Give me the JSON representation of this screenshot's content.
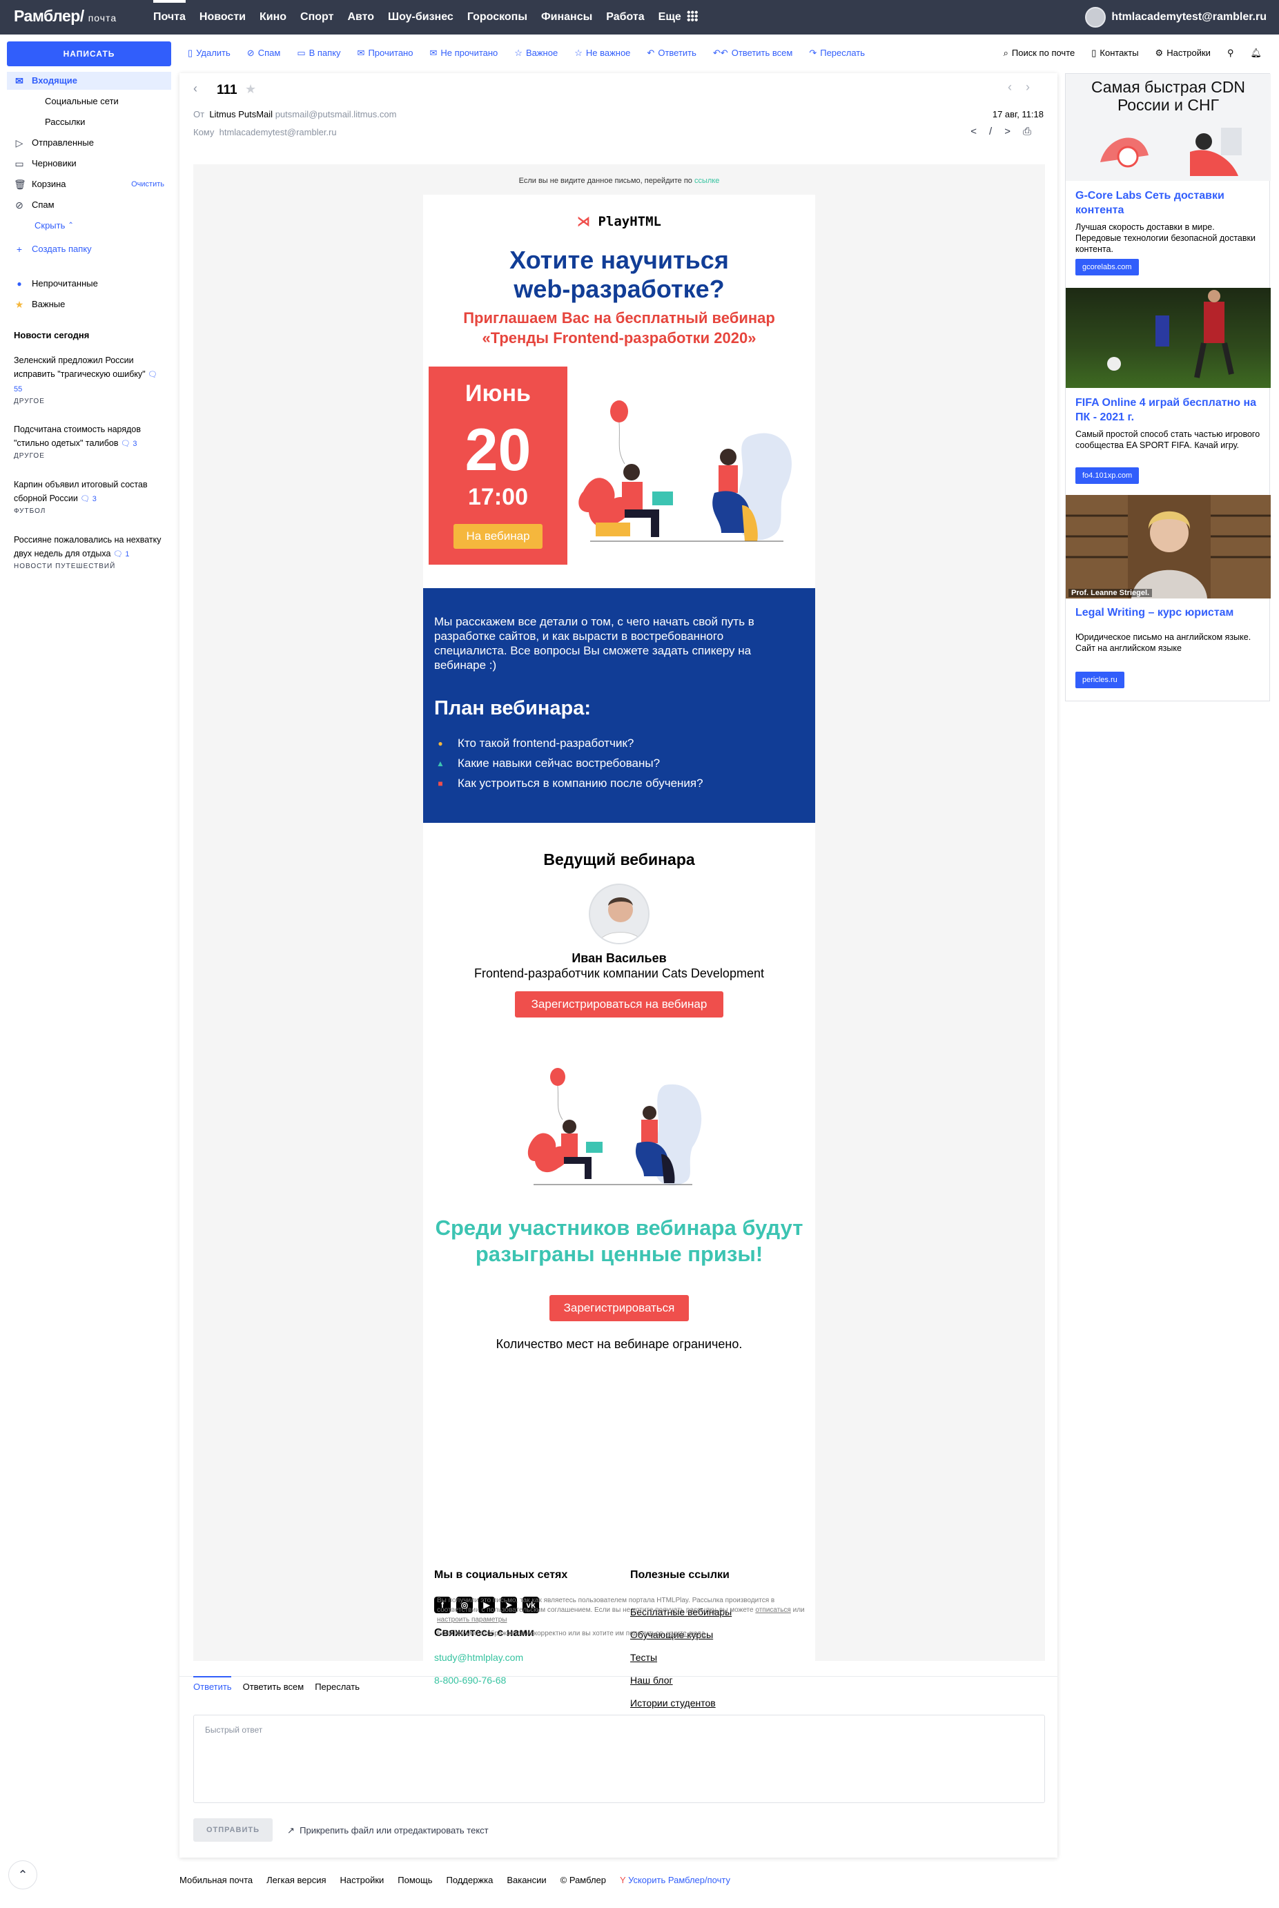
{
  "topbar": {
    "logo": "Рамблер/",
    "logo_sub": "почта",
    "nav": [
      "Почта",
      "Новости",
      "Кино",
      "Спорт",
      "Авто",
      "Шоу-бизнес",
      "Гороскопы",
      "Финансы",
      "Работа",
      "Еще"
    ],
    "account": "htmlacademytest@rambler.ru"
  },
  "sidebar": {
    "compose": "НАПИСАТЬ",
    "folders": {
      "inbox": "Входящие",
      "social": "Социальные сети",
      "mailings": "Рассылки",
      "sent": "Отправленные",
      "drafts": "Черновики",
      "trash": "Корзина",
      "trash_action": "Очистить",
      "spam": "Спам",
      "hide": "Скрыть",
      "create": "Создать папку",
      "unread": "Непрочитанные",
      "important": "Важные"
    },
    "news_title": "Новости сегодня",
    "news": [
      {
        "text": "Зеленский предложил России исправить \"трагическую ошибку\"",
        "comments": "55",
        "category": "ДРУГОЕ"
      },
      {
        "text": "Подсчитана стоимость нарядов \"стильно одетых\" талибов",
        "comments": "3",
        "category": "ДРУГОЕ"
      },
      {
        "text": "Карпин объявил итоговый состав сборной России",
        "comments": "3",
        "category": "ФУТБОЛ"
      },
      {
        "text": "Россияне пожаловались на нехватку двух недель для отдыха",
        "comments": "1",
        "category": "НОВОСТИ ПУТЕШЕСТВИЙ"
      }
    ]
  },
  "toolbar": {
    "delete": "Удалить",
    "spam": "Спам",
    "to_folder": "В папку",
    "read": "Прочитано",
    "unread": "Не прочитано",
    "important": "Важное",
    "not_important": "Не важное",
    "reply": "Ответить",
    "reply_all": "Ответить всем",
    "forward": "Переслать",
    "search": "Поиск по почте",
    "contacts": "Контакты",
    "settings": "Настройки"
  },
  "message": {
    "subject": "111",
    "from_label": "От",
    "from_name": "Litmus PutsMail",
    "from_email": "putsmail@putsmail.litmus.com",
    "to_label": "Кому",
    "to_email": "htmlacademytest@rambler.ru",
    "date": "17 авг, 11:18"
  },
  "email": {
    "noview_text": "Если вы не видите данное письмо, перейдите по",
    "noview_link": "ссылке",
    "brand": "PlayHTML",
    "h1_line1": "Хотите научиться",
    "h1_line2": "web-разработке?",
    "h2_line1": "Приглашаем Вас на бесплатный вебинар",
    "h2_line2": "«Тренды Frontend-разработки 2020»",
    "month": "Июнь",
    "day": "20",
    "time": "17:00",
    "date_button": "На вебинар",
    "intro": "Мы расскажем все детали о том, с чего начать свой путь в разработке сайтов, и как вырасти в востребованного специалиста. Все вопросы Вы сможете задать спикеру на вебинаре :)",
    "plan_title": "План вебинара:",
    "plan": [
      "Кто такой frontend-разработчик?",
      "Какие навыки сейчас востребованы?",
      "Как устроиться в компанию после обучения?"
    ],
    "plan_colors": [
      "#f5b73d",
      "#3cc4b2",
      "#ef4f4c"
    ],
    "host_title": "Ведущий вебинара",
    "host_name": "Иван Васильев",
    "host_role": "Frontend-разработчик компании Cats Development",
    "register_webinar": "Зарегистрироваться на вебинар",
    "prize_line1": "Среди участников вебинара будут",
    "prize_line2": "разыграны ценные призы!",
    "register": "Зарегистрироваться",
    "limited": "Количество мест на вебинаре ограничено.",
    "social_title": "Мы в социальных сетях",
    "social_icons": [
      "facebook-icon",
      "instagram-icon",
      "youtube-icon",
      "telegram-icon",
      "vk-icon"
    ],
    "contact_title": "Свяжитесь с нами",
    "contact_email": "study@htmlplay.com",
    "contact_phone": "8-800-690-76-68",
    "links_title": "Полезные ссылки",
    "links": [
      "Бесплатные вебинары",
      "Обучающие курсы",
      "Тесты",
      "Наш блог",
      "Истории студентов"
    ],
    "legal_1": "Вы получили это письмо, так как являетесь пользователем портала HTMLPlay. Рассылка производится в соответствии с пользовательским соглашением. Если вы не хотите получать рассылку, вы можете",
    "legal_unsub": "отписаться",
    "legal_or": "или",
    "legal_settings": "настроить параметры",
    "legal_2": "Если письмо отображается некорректно или вы хотите им поделиться,",
    "legal_here": "жмите сюда",
    "accent": "#113d96",
    "red": "#ef4f4c",
    "teal": "#3cc4b2"
  },
  "reply": {
    "tabs": [
      "Ответить",
      "Ответить всем",
      "Переслать"
    ],
    "placeholder": "Быстрый ответ",
    "send": "ОТПРАВИТЬ",
    "attach": "Прикрепить файл или отредактировать текст"
  },
  "ads": [
    {
      "banner": "Самая быстрая CDN России и СНГ",
      "title": "G-Core Labs Сеть доставки контента",
      "desc": "Лучшая скорость доставки в мире. Передовые технологии безопасной доставки контента.",
      "url": "gcorelabs.com"
    },
    {
      "title": "FIFA Online 4 играй бесплатно на ПК - 2021 г.",
      "desc": "Самый простой способ стать частью игрового сообщества EA SPORT FIFA. Качай игру.",
      "url": "fo4.101xp.com"
    },
    {
      "caption": "Prof. Leanne Striegel.",
      "title": "Legal Writing – курс юристам",
      "desc": "Юридическое письмо на английском языке. Сайт на английском языке",
      "url": "pericles.ru"
    }
  ],
  "footer": [
    "Мобильная почта",
    "Легкая версия",
    "Настройки",
    "Помощь",
    "Поддержка",
    "Вакансии",
    "© Рамблер",
    "Ускорить Рамблер/почту"
  ],
  "brand_color": "#315efb"
}
